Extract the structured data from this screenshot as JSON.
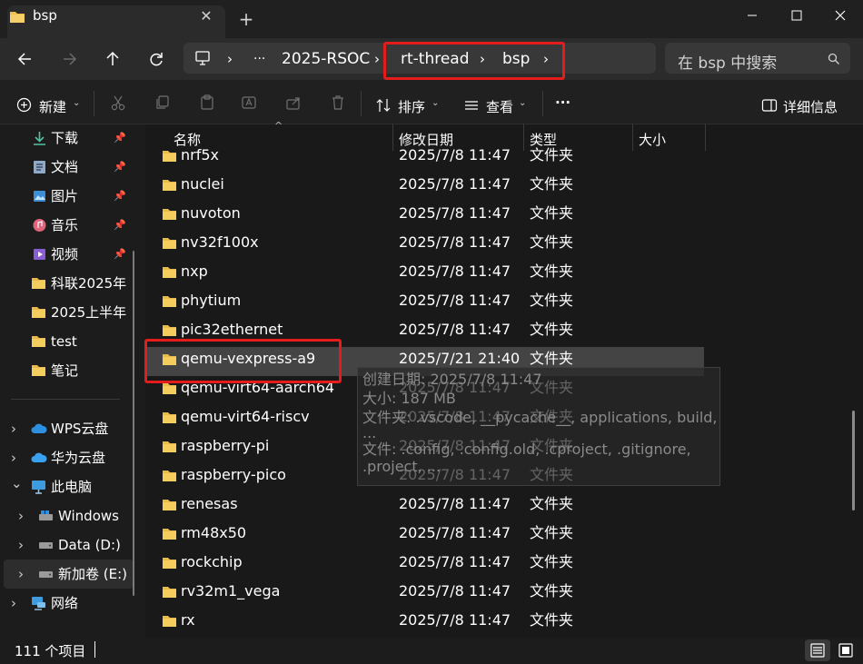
{
  "tab": {
    "title": "bsp",
    "close_glyph": "✕",
    "new_tab_glyph": "+"
  },
  "address": {
    "ellipsis": "···",
    "crumbs": [
      "2025-RSOC",
      "rt-thread",
      "bsp"
    ]
  },
  "search": {
    "placeholder": "在 bsp 中搜索"
  },
  "toolbar": {
    "new_label": "新建",
    "sort_label": "排序",
    "view_label": "查看",
    "more_label": "···",
    "details_label": "详细信息"
  },
  "sidebar": {
    "quick_access": [
      {
        "label": "下载",
        "icon": "download-icon",
        "pinned": true
      },
      {
        "label": "文档",
        "icon": "document-icon",
        "pinned": true
      },
      {
        "label": "图片",
        "icon": "picture-icon",
        "pinned": true
      },
      {
        "label": "音乐",
        "icon": "music-icon",
        "pinned": true
      },
      {
        "label": "视频",
        "icon": "video-icon",
        "pinned": true
      },
      {
        "label": "科联2025年",
        "icon": "folder-icon",
        "pinned": false
      },
      {
        "label": "2025上半年",
        "icon": "folder-icon",
        "pinned": false
      },
      {
        "label": "test",
        "icon": "folder-icon",
        "pinned": false
      },
      {
        "label": "笔记",
        "icon": "folder-icon",
        "pinned": false
      }
    ],
    "locations": [
      {
        "label": "WPS云盘",
        "icon": "cloud-icon",
        "expander": "›"
      },
      {
        "label": "华为云盘",
        "icon": "cloud-icon",
        "expander": "›"
      },
      {
        "label": "此电脑",
        "icon": "computer-icon",
        "expander": "⌄"
      },
      {
        "label": "Windows",
        "icon": "drive-icon",
        "expander": "›"
      },
      {
        "label": "Data (D:)",
        "icon": "drive-icon",
        "expander": "›"
      },
      {
        "label": "新加卷 (E:)",
        "icon": "drive-icon",
        "expander": "›"
      },
      {
        "label": "网络",
        "icon": "network-icon",
        "expander": "›"
      }
    ]
  },
  "columns": {
    "name": "名称",
    "date": "修改日期",
    "type": "类型",
    "size": "大小"
  },
  "files": [
    {
      "name": "nrf5x",
      "date": "2025/7/8 11:47",
      "type": "文件夹"
    },
    {
      "name": "nuclei",
      "date": "2025/7/8 11:47",
      "type": "文件夹"
    },
    {
      "name": "nuvoton",
      "date": "2025/7/8 11:47",
      "type": "文件夹"
    },
    {
      "name": "nv32f100x",
      "date": "2025/7/8 11:47",
      "type": "文件夹"
    },
    {
      "name": "nxp",
      "date": "2025/7/8 11:47",
      "type": "文件夹"
    },
    {
      "name": "phytium",
      "date": "2025/7/8 11:47",
      "type": "文件夹"
    },
    {
      "name": "pic32ethernet",
      "date": "2025/7/8 11:47",
      "type": "文件夹"
    },
    {
      "name": "qemu-vexpress-a9",
      "date": "2025/7/21 21:40",
      "type": "文件夹",
      "selected": true
    },
    {
      "name": "qemu-virt64-aarch64",
      "date": "2025/7/8 11:47",
      "type": "文件夹"
    },
    {
      "name": "qemu-virt64-riscv",
      "date": "2025/7/8 11:47",
      "type": "文件夹"
    },
    {
      "name": "raspberry-pi",
      "date": "2025/7/8 11:47",
      "type": "文件夹"
    },
    {
      "name": "raspberry-pico",
      "date": "2025/7/8 11:47",
      "type": "文件夹"
    },
    {
      "name": "renesas",
      "date": "2025/7/8 11:47",
      "type": "文件夹"
    },
    {
      "name": "rm48x50",
      "date": "2025/7/8 11:47",
      "type": "文件夹"
    },
    {
      "name": "rockchip",
      "date": "2025/7/8 11:47",
      "type": "文件夹"
    },
    {
      "name": "rv32m1_vega",
      "date": "2025/7/8 11:47",
      "type": "文件夹"
    },
    {
      "name": "rx",
      "date": "2025/7/8 11:47",
      "type": "文件夹"
    }
  ],
  "tooltip": {
    "lines": [
      "创建日期: 2025/7/8 11:47",
      "大小: 187 MB",
      "文件夹: .vscode, __pycache__, applications, build,",
      "...",
      "文件: .config, .config.old, .cproject, .gitignore,",
      ".project, ..."
    ]
  },
  "status": {
    "item_count": "111 个项目"
  },
  "colors": {
    "highlight": "#e41c1c",
    "folder": "#f0c050",
    "selected_row": "#444444"
  }
}
